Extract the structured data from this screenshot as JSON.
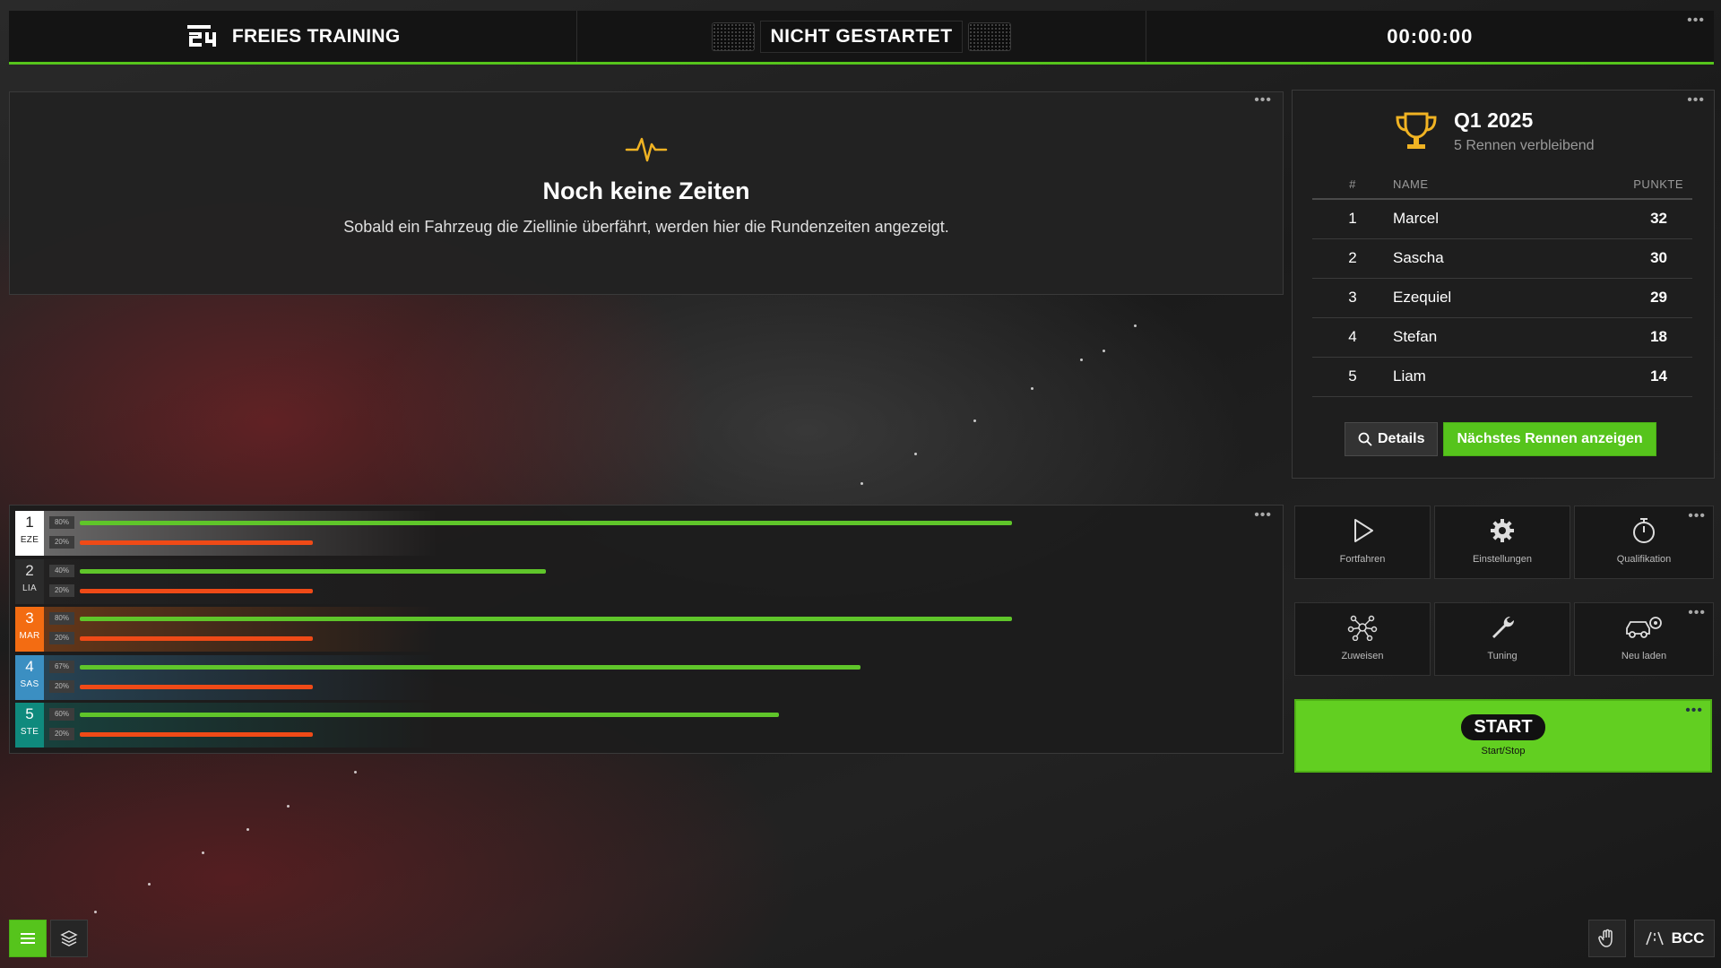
{
  "header": {
    "session_title": "FREIES TRAINING",
    "status": "NICHT GESTARTET",
    "timer": "00:00:00"
  },
  "lap_times": {
    "title": "Noch keine Zeiten",
    "message": "Sobald ein Fahrzeug die Ziellinie überfährt, werden hier die Rundenzeiten angezeigt."
  },
  "standings": {
    "title": "Q1 2025",
    "subtitle": "5 Rennen verbleibend",
    "columns": [
      "#",
      "NAME",
      "PUNKTE"
    ],
    "rows": [
      {
        "pos": "1",
        "name": "Marcel",
        "points": "32"
      },
      {
        "pos": "2",
        "name": "Sascha",
        "points": "30"
      },
      {
        "pos": "3",
        "name": "Ezequiel",
        "points": "29"
      },
      {
        "pos": "4",
        "name": "Stefan",
        "points": "18"
      },
      {
        "pos": "5",
        "name": "Liam",
        "points": "14"
      }
    ],
    "details_button": "Details",
    "next_race_button": "Nächstes Rennen anzeigen"
  },
  "drivers": [
    {
      "pos": "1",
      "code": "EZE",
      "color": "#ffffff",
      "text_color": "#222222",
      "green_pct": "80%",
      "green": 0.8,
      "red_pct": "20%",
      "red": 0.2
    },
    {
      "pos": "2",
      "code": "LIA",
      "color": "#2b2b2b",
      "text_color": "#dddddd",
      "green_pct": "40%",
      "green": 0.4,
      "red_pct": "20%",
      "red": 0.2
    },
    {
      "pos": "3",
      "code": "MAR",
      "color": "#f36c12",
      "text_color": "#ffffff",
      "green_pct": "80%",
      "green": 0.8,
      "red_pct": "20%",
      "red": 0.2
    },
    {
      "pos": "4",
      "code": "SAS",
      "color": "#3b8fc2",
      "text_color": "#ffffff",
      "green_pct": "67%",
      "green": 0.67,
      "red_pct": "20%",
      "red": 0.2
    },
    {
      "pos": "5",
      "code": "STE",
      "color": "#0f8a7d",
      "text_color": "#ffffff",
      "green_pct": "60%",
      "green": 0.6,
      "red_pct": "20%",
      "red": 0.2
    }
  ],
  "controls": {
    "continue": "Fortfahren",
    "settings": "Einstellungen",
    "qualifying": "Qualifikation",
    "assign": "Zuweisen",
    "tuning": "Tuning",
    "reload": "Neu laden",
    "start": "START",
    "start_sub": "Start/Stop"
  },
  "footer": {
    "bcc_label": "BCC"
  },
  "colors": {
    "accent_green": "#56c41c",
    "bar_red": "#ef4a17",
    "trophy_gold": "#f0b323"
  },
  "icons": [
    "pulse-icon",
    "trophy-icon",
    "search-icon",
    "play-icon",
    "gear-icon",
    "stopwatch-icon",
    "network-icon",
    "wrench-icon",
    "car-reload-icon",
    "menu-icon",
    "layers-icon",
    "hand-icon",
    "road-icon"
  ]
}
